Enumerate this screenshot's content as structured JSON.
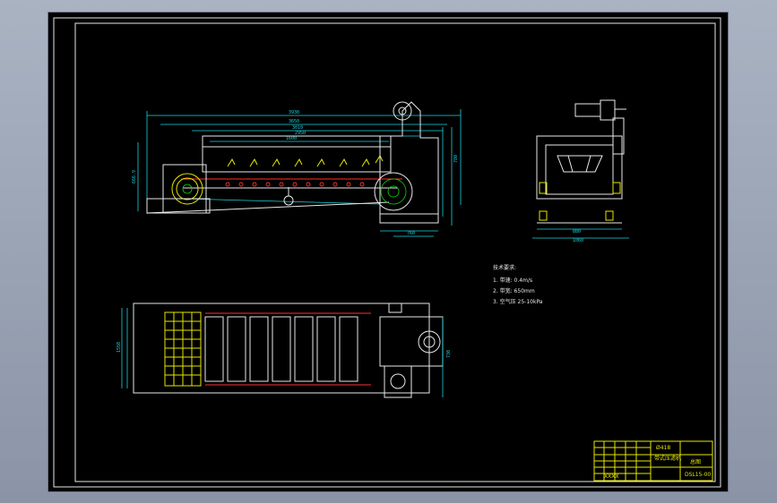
{
  "drawing": {
    "front_view": {
      "dims_top": [
        "3930",
        "3650",
        "3010",
        "2950",
        "2470"
      ],
      "dim_mid": "1600",
      "dim_left": "666.9",
      "dim_right": "780",
      "dim_bottom": "760"
    },
    "side_view": {
      "dim_bottom1": "880",
      "dim_bottom2": "1060"
    },
    "plan_view": {
      "dim_left": "1550",
      "dim_right": "730"
    },
    "notes": {
      "title": "技术要求:",
      "items": [
        "1. 带速: 0.4m/s",
        "2. 带宽: 650mm",
        "3. 空气压 25-10kPa"
      ]
    },
    "title_block": {
      "scale": "Ø418",
      "name": "带式压滤机",
      "drawing_no": "总图",
      "code": "DSL15-00",
      "org": "XXXX"
    }
  }
}
